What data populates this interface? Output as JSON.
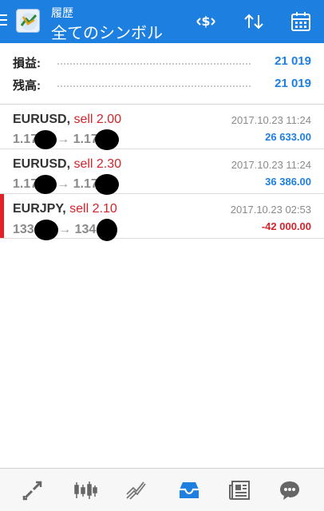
{
  "header": {
    "subtitle": "履歴",
    "title": "全てのシンボル"
  },
  "summary": [
    {
      "label": "損益:",
      "value": "21 019"
    },
    {
      "label": "残高:",
      "value": "21 019"
    }
  ],
  "trades": [
    {
      "symbol": "EURUSD",
      "side": "sell 2.00",
      "open_price": "1.17",
      "close_price": "1.17",
      "time": "2017.10.23 11:24",
      "profit": "26 633.00"
    },
    {
      "symbol": "EURUSD",
      "side": "sell 2.30",
      "open_price": "1.17",
      "close_price": "1.17",
      "time": "2017.10.23 11:24",
      "profit": "36 386.00"
    },
    {
      "symbol": "EURJPY",
      "side": "sell 2.10",
      "open_price": "133.",
      "close_price": "134.",
      "time": "2017.10.23 02:53",
      "profit": "-42 000.00"
    }
  ],
  "colors": {
    "accent": "#1d7fe0",
    "loss": "#d6222a"
  },
  "bottom_nav": [
    "trade-icon",
    "quotes-chart-icon",
    "chart-icon",
    "history-inbox-icon",
    "news-icon",
    "chat-icon"
  ]
}
